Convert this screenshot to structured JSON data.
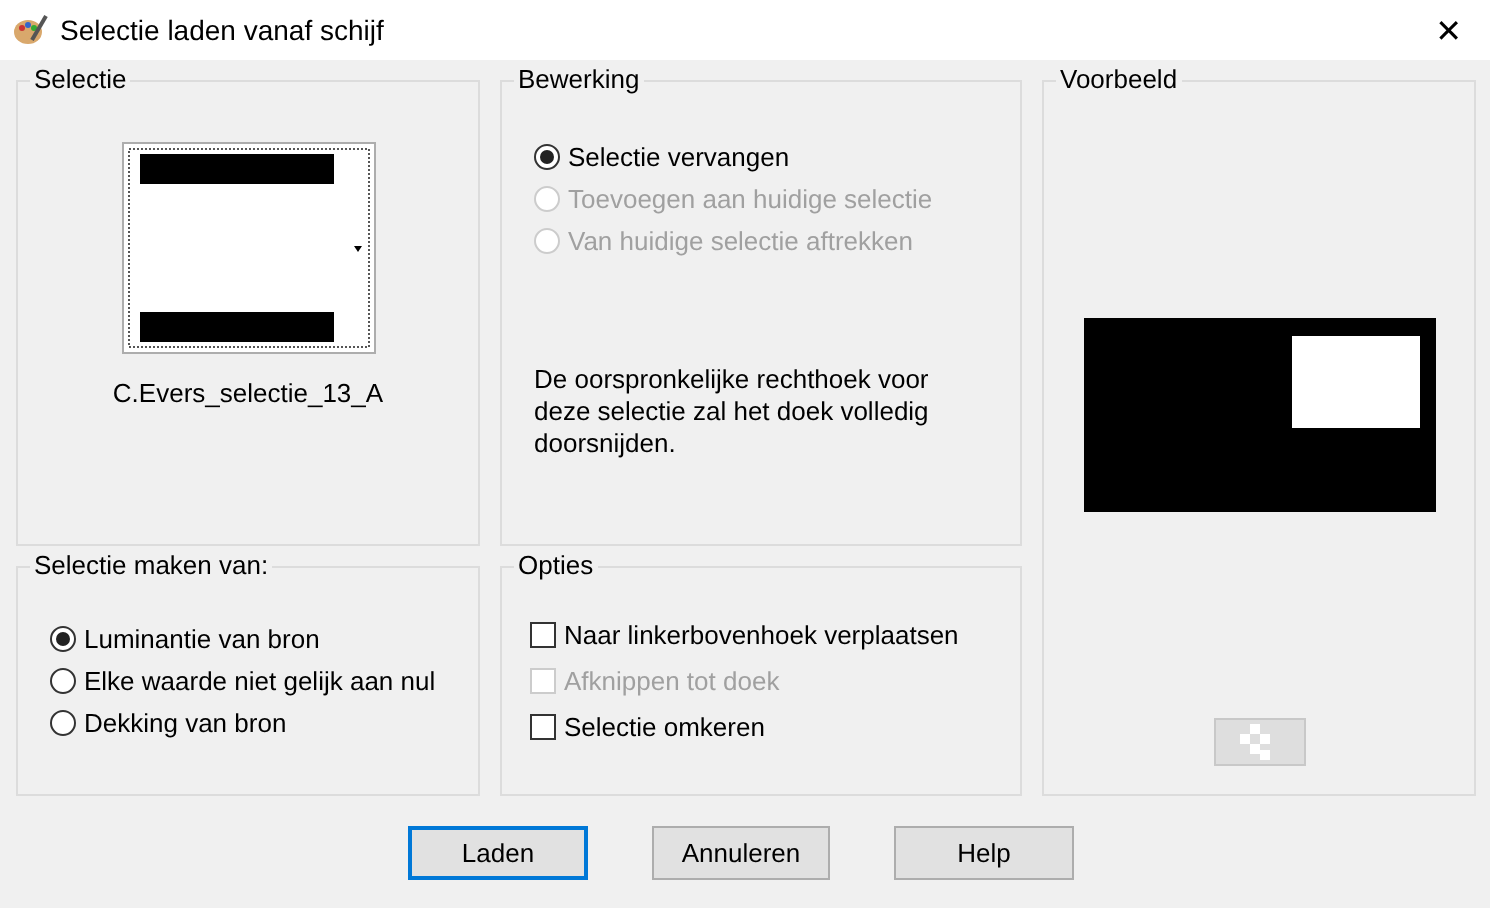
{
  "window": {
    "title": "Selectie laden vanaf schijf",
    "close": "✕"
  },
  "selectie": {
    "title": "Selectie",
    "file_name": "C.Evers_selectie_13_A"
  },
  "bewerking": {
    "title": "Bewerking",
    "options": [
      {
        "label": "Selectie vervangen",
        "selected": true,
        "disabled": false
      },
      {
        "label": "Toevoegen aan huidige selectie",
        "selected": false,
        "disabled": true
      },
      {
        "label": "Van huidige selectie aftrekken",
        "selected": false,
        "disabled": true
      }
    ],
    "note": "De oorspronkelijke rechthoek voor deze selectie zal het doek volledig doorsnijden."
  },
  "voorbeeld": {
    "title": "Voorbeeld"
  },
  "bron": {
    "title": "Selectie maken van:",
    "options": [
      {
        "label": "Luminantie van bron",
        "selected": true,
        "disabled": false
      },
      {
        "label": "Elke waarde niet gelijk aan nul",
        "selected": false,
        "disabled": false
      },
      {
        "label": "Dekking van bron",
        "selected": false,
        "disabled": false
      }
    ]
  },
  "opties": {
    "title": "Opties",
    "options": [
      {
        "label": "Naar linkerbovenhoek verplaatsen",
        "checked": false,
        "disabled": false
      },
      {
        "label": "Afknippen tot doek",
        "checked": false,
        "disabled": true
      },
      {
        "label": "Selectie omkeren",
        "checked": false,
        "disabled": false
      }
    ]
  },
  "buttons": [
    {
      "label": "Laden",
      "default": true
    },
    {
      "label": "Annuleren",
      "default": false
    },
    {
      "label": "Help",
      "default": false
    }
  ]
}
